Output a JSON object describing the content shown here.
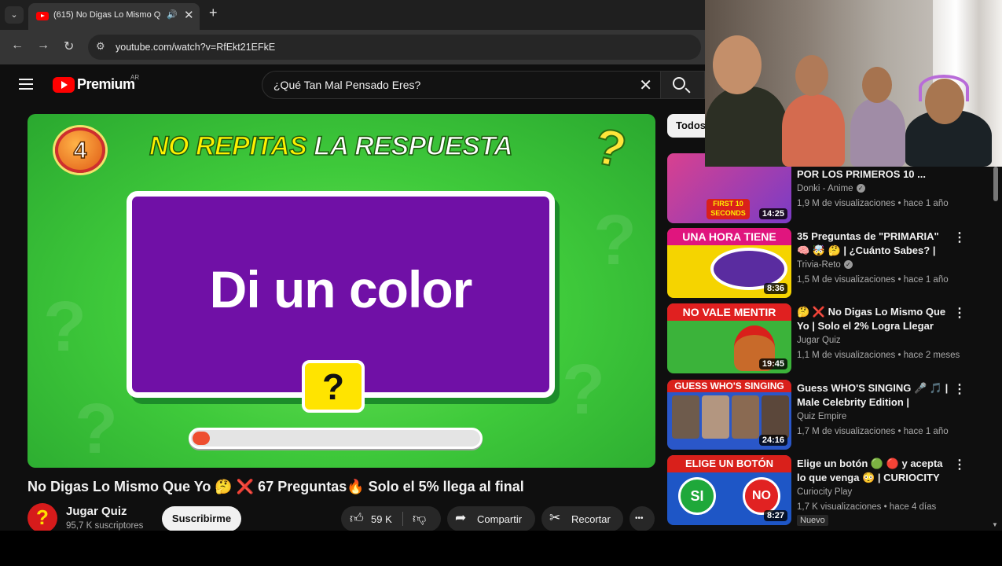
{
  "browser": {
    "tab_title": "(615) No Digas Lo Mismo Q",
    "url": "youtube.com/watch?v=RfEkt21EFkE"
  },
  "header": {
    "logo_text": "Premium",
    "country": "AR",
    "search_value": "¿Qué Tan Mal Pensado Eres?"
  },
  "player": {
    "badge_number": "4",
    "headline_part1": "NO REPITAS",
    "headline_part2": "LA RESPUESTA",
    "prompt": "Di un color",
    "qbox": "?",
    "corner_q": "?",
    "progress_fraction": 0.06
  },
  "video": {
    "title": "No Digas Lo Mismo Que Yo 🤔 ❌ 67 Preguntas🔥 Solo el 5% llega al final",
    "channel": "Jugar Quiz",
    "subscribers": "95,7 K suscriptores",
    "subscribe_label": "Suscribirme",
    "likes": "59 K",
    "share_label": "Compartir",
    "clip_label": "Recortar",
    "more_label": "•••"
  },
  "sidebar": {
    "chip_label": "Todos",
    "items": [
      {
        "title": "POR LOS PRIMEROS 10 ...",
        "channel": "Donki - Anime",
        "verified": true,
        "meta": "1,9 M de visualizaciones • hace 1 año",
        "duration": "14:25",
        "thumb_text": "FIRST 10 SECONDS",
        "thumb_color": "#d9418f"
      },
      {
        "title": "35 Preguntas de \"PRIMARIA\" 🧠 🤯 🤔 | ¿Cuánto Sabes? | Trivi...",
        "channel": "Trivia-Reto",
        "verified": true,
        "meta": "1,5 M de visualizaciones • hace 1 año",
        "duration": "8:36",
        "thumb_text": "UNA HORA TIENE",
        "thumb_color": "#e0157e"
      },
      {
        "title": "🤔 ❌ No Digas Lo Mismo Que Yo | Solo el 2% Logra Llegar",
        "channel": "Jugar Quiz",
        "verified": false,
        "meta": "1,1 M de visualizaciones • hace 2 meses",
        "duration": "19:45",
        "thumb_text": "NO VALE MENTIR",
        "thumb_color": "#3bb33a"
      },
      {
        "title": "Guess WHO'S SINGING 🎤 🎵 | Male Celebrity Edition | Justin...",
        "channel": "Quiz Empire",
        "verified": false,
        "meta": "1,7 M de visualizaciones • hace 1 año",
        "duration": "24:16",
        "thumb_text": "GUESS WHO'S SINGING",
        "thumb_color": "#2a57c9"
      },
      {
        "title": "Elige un botón 🟢 🔴 y acepta lo que venga 😳 | CURIOCITY ...",
        "channel": "Curiocity Play",
        "verified": false,
        "meta": "1,7 K visualizaciones • hace 4 días",
        "duration": "8:27",
        "thumb_text": "ELIGE UN BOTÓN",
        "thumb_color": "#1e56c6",
        "badge": "Nuevo"
      }
    ]
  },
  "colors": {
    "accent_red": "#ff0000",
    "player_green": "#3fca3b",
    "card_purple": "#7010a6",
    "headline_yellow": "#fff000"
  }
}
